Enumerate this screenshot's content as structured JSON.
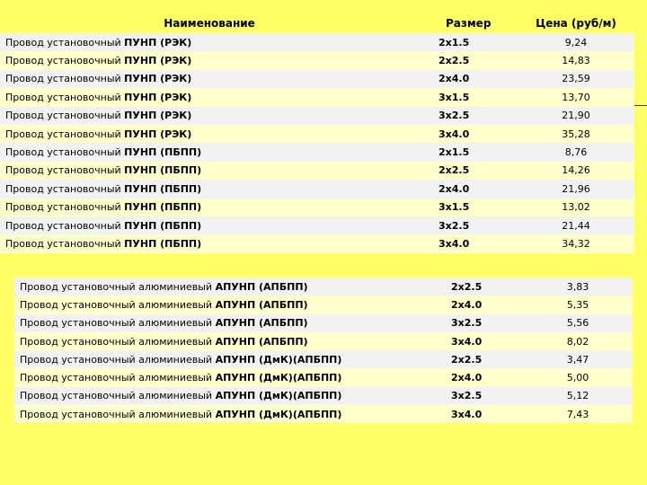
{
  "table1": {
    "headers": {
      "name": "Наименование",
      "size": "Размер",
      "price": "Цена (руб/м)"
    },
    "rows": [
      {
        "prefix": "Провод установочный ",
        "brand": "ПУНП (РЭК)",
        "size": "2х1.5",
        "price": "9,24"
      },
      {
        "prefix": "Провод установочный ",
        "brand": "ПУНП (РЭК)",
        "size": "2х2.5",
        "price": "14,83"
      },
      {
        "prefix": "Провод установочный ",
        "brand": "ПУНП (РЭК)",
        "size": "2х4.0",
        "price": "23,59"
      },
      {
        "prefix": "Провод установочный ",
        "brand": "ПУНП (РЭК)",
        "size": "3х1.5",
        "price": "13,70"
      },
      {
        "prefix": "Провод установочный ",
        "brand": "ПУНП (РЭК)",
        "size": "3х2.5",
        "price": "21,90"
      },
      {
        "prefix": "Провод установочный ",
        "brand": "ПУНП (РЭК)",
        "size": "3х4.0",
        "price": "35,28"
      },
      {
        "prefix": "Провод установочный ",
        "brand": "ПУНП (ПБПП)",
        "size": "2х1.5",
        "price": "8,76"
      },
      {
        "prefix": "Провод установочный ",
        "brand": "ПУНП (ПБПП)",
        "size": "2х2.5",
        "price": "14,26"
      },
      {
        "prefix": "Провод установочный ",
        "brand": "ПУНП (ПБПП)",
        "size": "2х4.0",
        "price": "21,96"
      },
      {
        "prefix": "Провод установочный ",
        "brand": "ПУНП (ПБПП)",
        "size": "3х1.5",
        "price": "13,02"
      },
      {
        "prefix": "Провод установочный ",
        "brand": "ПУНП (ПБПП)",
        "size": "3х2.5",
        "price": "21,44"
      },
      {
        "prefix": "Провод установочный ",
        "brand": "ПУНП (ПБПП)",
        "size": "3х4.0",
        "price": "34,32"
      }
    ]
  },
  "table2": {
    "rows": [
      {
        "prefix": "Провод установочный алюминиевый ",
        "brand": "АПУНП (АПБПП)",
        "size": "2х2.5",
        "price": "3,83"
      },
      {
        "prefix": "Провод установочный алюминиевый ",
        "brand": "АПУНП (АПБПП)",
        "size": "2х4.0",
        "price": "5,35"
      },
      {
        "prefix": "Провод установочный алюминиевый ",
        "brand": "АПУНП (АПБПП)",
        "size": "3х2.5",
        "price": "5,56"
      },
      {
        "prefix": "Провод установочный алюминиевый ",
        "brand": "АПУНП (АПБПП)",
        "size": "3х4.0",
        "price": "8,02"
      },
      {
        "prefix": "Провод установочный алюминиевый ",
        "brand": "АПУНП (ДмК)(АПБПП)",
        "size": "2х2.5",
        "price": "3,47"
      },
      {
        "prefix": "Провод установочный алюминиевый ",
        "brand": "АПУНП (ДмК)(АПБПП)",
        "size": "2х4.0",
        "price": "5,00"
      },
      {
        "prefix": "Провод установочный алюминиевый ",
        "brand": "АПУНП (ДмК)(АПБПП)",
        "size": "3х2.5",
        "price": "5,12"
      },
      {
        "prefix": "Провод установочный алюминиевый ",
        "brand": "АПУНП (ДмК)(АПБПП)",
        "size": "3х4.0",
        "price": "7,43"
      }
    ]
  }
}
